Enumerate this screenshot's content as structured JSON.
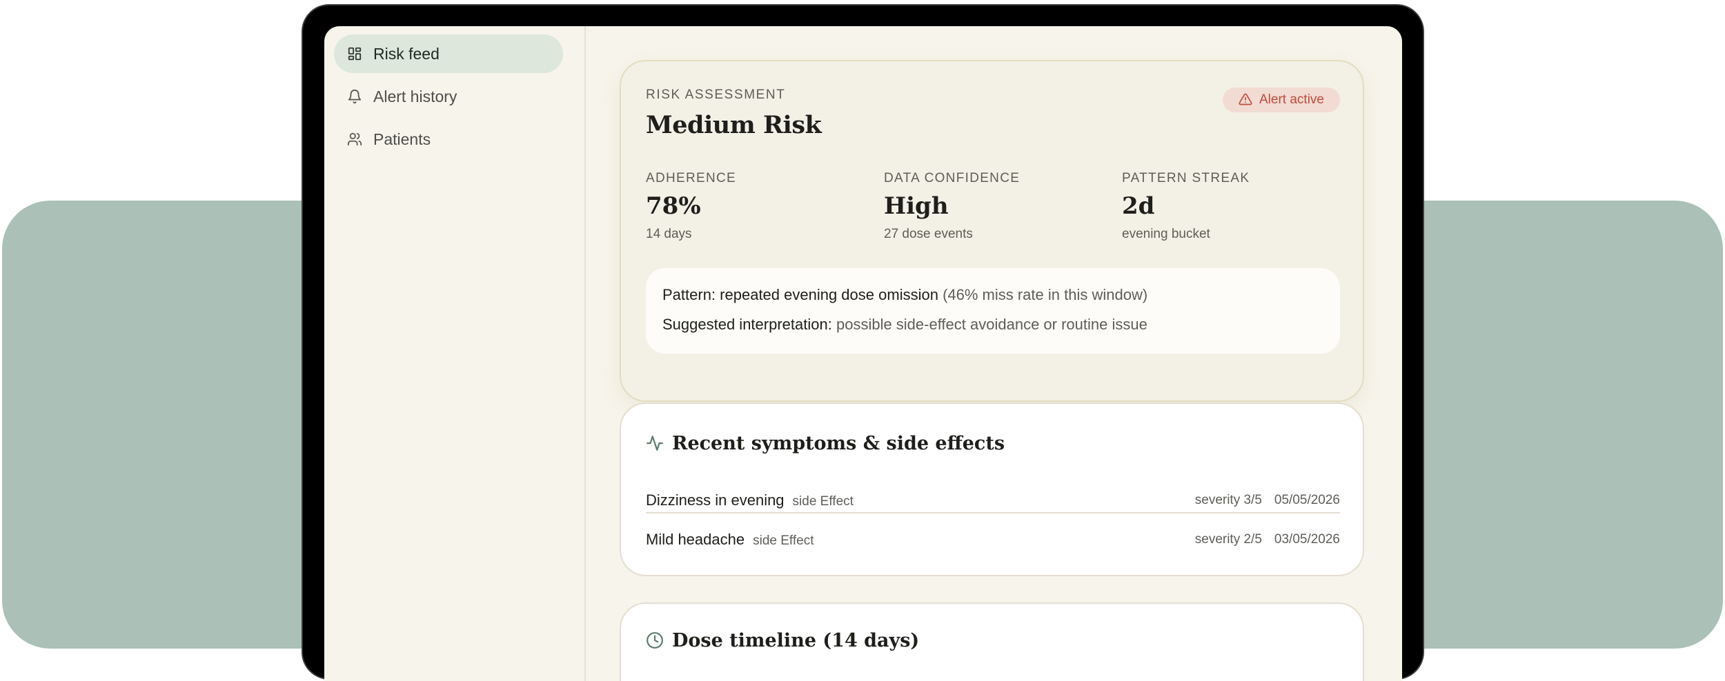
{
  "sidebar": {
    "items": [
      {
        "label": "Risk feed",
        "icon": "dashboard-icon",
        "active": true
      },
      {
        "label": "Alert history",
        "icon": "bell-icon",
        "active": false
      },
      {
        "label": "Patients",
        "icon": "users-icon",
        "active": false
      }
    ]
  },
  "risk": {
    "overline": "RISK ASSESSMENT",
    "title": "Medium Risk",
    "badge": "Alert active",
    "metrics": [
      {
        "label": "ADHERENCE",
        "value": "78%",
        "sub": "14 days"
      },
      {
        "label": "DATA CONFIDENCE",
        "value": "High",
        "sub": "27 dose events"
      },
      {
        "label": "PATTERN STREAK",
        "value": "2d",
        "sub": "evening bucket"
      }
    ],
    "pattern_label": "Pattern:",
    "pattern_text": "repeated evening dose omission",
    "pattern_note": "(46% miss rate in this window)",
    "interp_label": "Suggested interpretation:",
    "interp_text": "possible side-effect avoidance or routine issue"
  },
  "symptoms": {
    "title": "Recent symptoms & side effects",
    "rows": [
      {
        "name": "Dizziness in evening",
        "type": "side Effect",
        "severity": "severity 3/5",
        "date": "05/05/2026"
      },
      {
        "name": "Mild headache",
        "type": "side Effect",
        "severity": "severity 2/5",
        "date": "03/05/2026"
      }
    ]
  },
  "dose": {
    "title": "Dose timeline (14 days)"
  },
  "colors": {
    "accent_green": "#dde7dc",
    "background_panel": "#abc0b7",
    "alert_red": "#bf4a3c",
    "alert_bg": "#f1dbd3"
  }
}
